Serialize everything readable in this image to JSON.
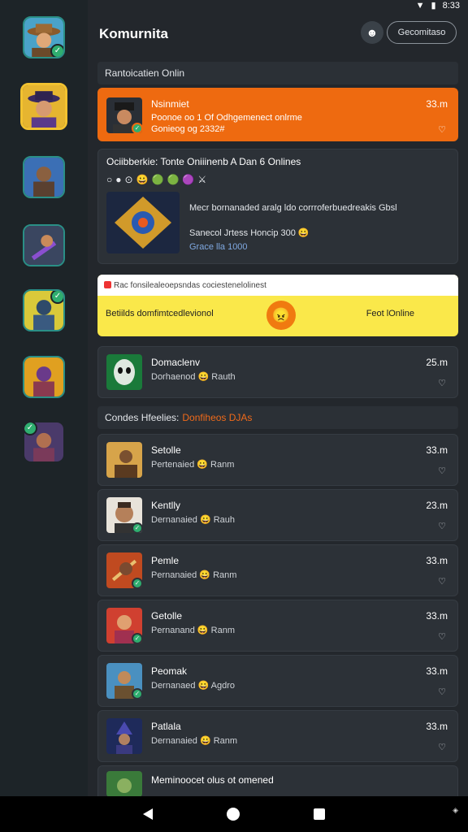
{
  "status_bar": {
    "time": "8:33"
  },
  "header": {
    "title": "Komurnita",
    "pill_label": "Gecomitaso"
  },
  "sections": {
    "online_title": "Rantoicatien Onlin",
    "recent_title": "Condeѕ Hfeelies:",
    "recent_accent": "Donfiheos DJAs"
  },
  "pinned": {
    "name": "Nsinmiet",
    "line1": "Poonoe oo 1 Of Odhgemenect onlrme",
    "line2": "Gonieog og 2332#",
    "time": "33.m"
  },
  "feature": {
    "title": "Ociibberkie: Tonte Oniiinenb A Dan 6 Onlines",
    "icons": [
      "○",
      "●",
      "⊙",
      "😀",
      "🟢",
      "🟢",
      "🟣",
      "⚔"
    ],
    "line1": "Mecr bornanaded aralg ldo corrroferbuedreakis Gbsl",
    "line2": "Sanecol Jrtess Honcip 300 😀",
    "line3": "Grace lla 1000"
  },
  "banner": {
    "top_text": "Rac fonsilealeoepsndas cociestenelolinest",
    "left_text": "Betiilds domfimtcedlevionol",
    "right_text": "Feot lOnline"
  },
  "single_chat": {
    "name": "Domaclenv",
    "sub": "Dorhaenod",
    "sub_tail": "Rauth",
    "time": "25.m"
  },
  "chats": [
    {
      "name": "Setolle",
      "sub": "Pertenaied",
      "tail": "Ranm",
      "time": "33.m"
    },
    {
      "name": "Kentlly",
      "sub": "Dernanaied",
      "tail": "Rauh",
      "time": "23.m"
    },
    {
      "name": "Pemle",
      "sub": "Pernanaied",
      "tail": "Ranm",
      "time": "33.m"
    },
    {
      "name": "Getolle",
      "sub": "Pernanand",
      "tail": "Ranm",
      "time": "33.m"
    },
    {
      "name": "Peomak",
      "sub": "Dernanaed",
      "tail": "Agdro",
      "time": "33.m"
    },
    {
      "name": "Patlala",
      "sub": "Dernanaied",
      "tail": "Ranm",
      "time": "33.m"
    }
  ],
  "last_row": {
    "name": "Meminoocet olus ot omened"
  },
  "colors": {
    "bg": "#23272c",
    "rail": "#1d2428",
    "card": "#2c3137",
    "orange": "#ee6a10",
    "yellow": "#fae84a",
    "online_green": "#2fae6f"
  }
}
